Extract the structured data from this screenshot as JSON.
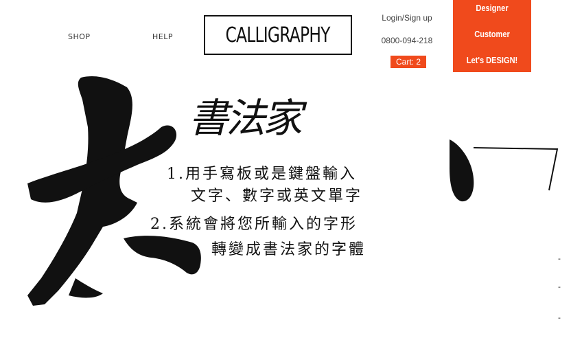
{
  "nav": {
    "shop": "SHOP",
    "help": "HELP"
  },
  "logo": {
    "text": "CALLIGRAPHY"
  },
  "account": {
    "login": "Login/Sign up",
    "phone": "0800-094-218",
    "cart": "Cart: 2"
  },
  "side_menu": {
    "designer": "Designer",
    "customer": "Customer",
    "design": "Let's DESIGN!"
  },
  "hero": {
    "big_char": "大",
    "title": "書法家",
    "step1_line1": "1.用手寫板或是鍵盤輸入",
    "step1_line2": "文字、數字或英文單字",
    "step2_line1": "2.系統會將您所輸入的字形",
    "step2_line2": "轉變成書法家的字體"
  },
  "side_dashes": [
    "-",
    "-",
    "-"
  ],
  "colors": {
    "accent": "#f04a1c",
    "ink": "#111111",
    "background": "#ffffff"
  }
}
